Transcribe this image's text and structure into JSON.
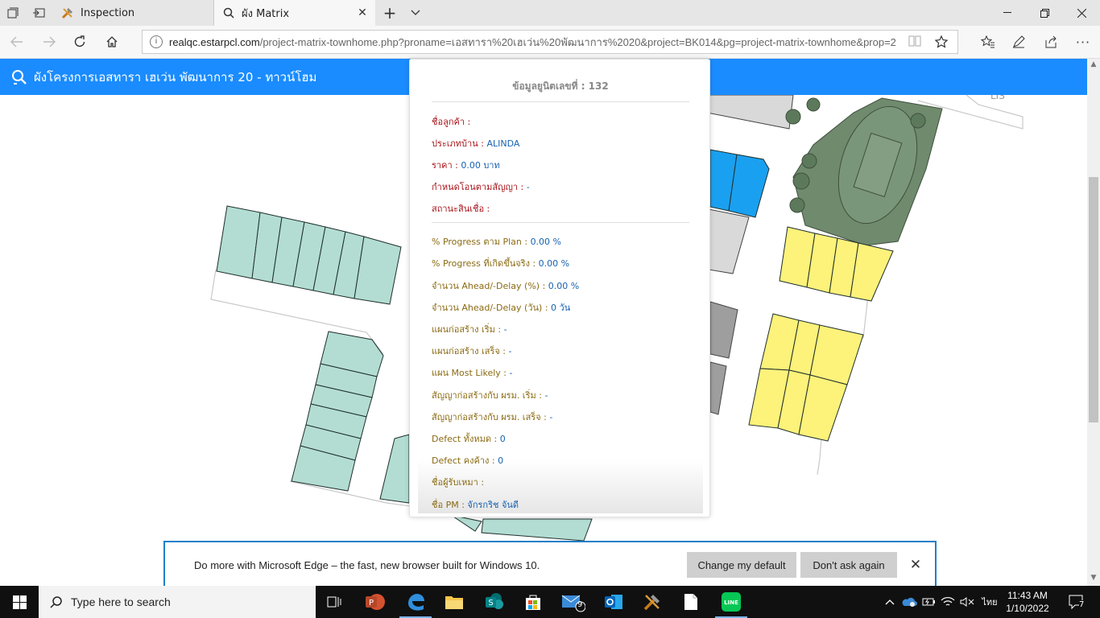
{
  "browser": {
    "tabs": [
      {
        "title": "Inspection",
        "icon": "tools-icon"
      },
      {
        "title": "ผัง Matrix",
        "icon": "search-icon"
      }
    ],
    "url": {
      "host": "realqc.estarpcl.com",
      "path": "/project-matrix-townhome.php?proname=เอสทารา%20เฮเว่น%20พัฒนาการ%2020&project=BK014&pg=project-matrix-townhome&prop=2"
    }
  },
  "page": {
    "header_title": "ผังโครงการเอสทารา เฮเว่น พัฒนาการ 20 - ทาวน์โฮม"
  },
  "popup": {
    "title": "ข้อมูลยูนิตเลขที่ : 132",
    "rows_top": [
      {
        "label": "ชื่อลูกค้า :",
        "value": ""
      },
      {
        "label": "ประเภทบ้าน :",
        "value": "ALINDA"
      },
      {
        "label": "ราคา :",
        "value": "0.00 บาท"
      },
      {
        "label": "กำหนดโอนตามสัญญา :",
        "value": "-"
      },
      {
        "label": "สถานะสินเชื่อ :",
        "value": ""
      }
    ],
    "rows_bottom": [
      {
        "label": "% Progress ตาม Plan :",
        "value": "0.00 %"
      },
      {
        "label": "% Progress ที่เกิดขึ้นจริง :",
        "value": "0.00 %"
      },
      {
        "label": "จำนวน Ahead/-Delay (%) :",
        "value": "0.00 %"
      },
      {
        "label": "จำนวน Ahead/-Delay (วัน) :",
        "value": "0 วัน"
      },
      {
        "label": "แผนก่อสร้าง เริ่ม :",
        "value": "-"
      },
      {
        "label": "แผนก่อสร้าง เสร็จ :",
        "value": "-"
      },
      {
        "label": "แผน Most Likely :",
        "value": "-"
      },
      {
        "label": "สัญญาก่อสร้างกับ ผรม. เริ่ม :",
        "value": "-"
      },
      {
        "label": "สัญญาก่อสร้างกับ ผรม. เสร็จ :",
        "value": "-"
      },
      {
        "label": "Defect ทั้งหมด :",
        "value": "0"
      },
      {
        "label": "Defect คงค้าง :",
        "value": "0"
      },
      {
        "label": "ชื่อผู้รับเหมา :",
        "value": ""
      },
      {
        "label": "ชื่อ PM :",
        "value": "จักรกริช จันดี"
      }
    ]
  },
  "banner": {
    "text": "Do more with Microsoft Edge – the fast, new browser built for Windows 10.",
    "change_default": "Change my default",
    "dont_ask": "Don't ask again"
  },
  "taskbar": {
    "search_placeholder": "Type here to search",
    "mail_badge": "9",
    "ime": "ไทย",
    "time": "11:43 AM",
    "date": "1/10/2022",
    "notifications": "7"
  },
  "map": {
    "label_fragment": "LIS"
  },
  "colors": {
    "header_blue": "#1a8cff",
    "unit_teal": "#b3ddd3",
    "unit_yellow": "#fdf27a",
    "unit_blue": "#1aa0f0",
    "unit_gray": "#d9d9d9",
    "park_green": "#6f8a6d"
  }
}
